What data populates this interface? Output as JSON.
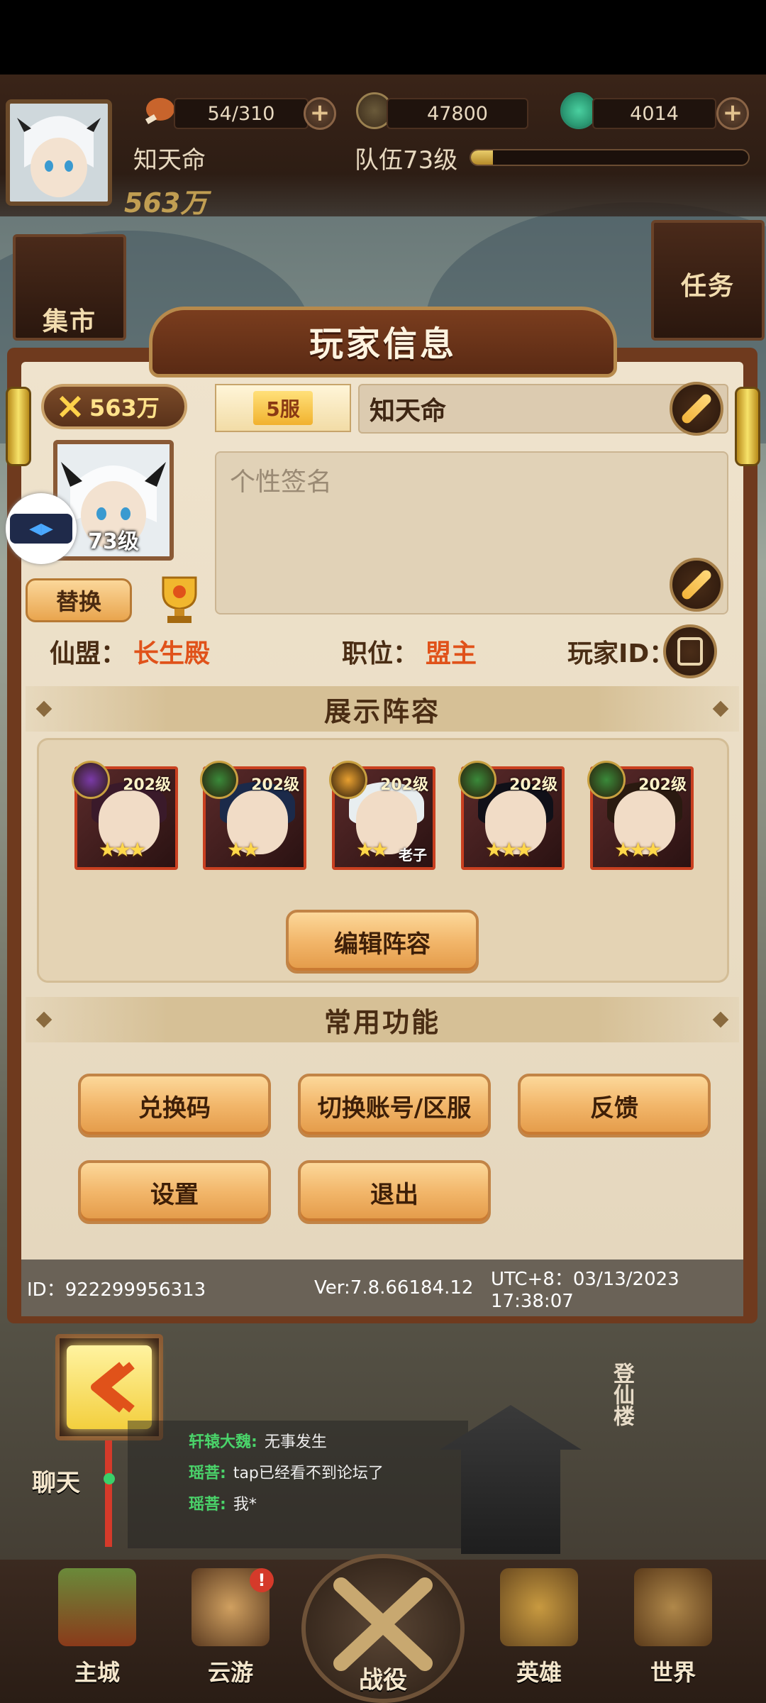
{
  "topbar": {
    "stamina": "54/310",
    "coins": "47800",
    "jade": "4014",
    "player_name": "知天命",
    "team_level": "队伍73级",
    "power": "563万",
    "plus": "+"
  },
  "side": {
    "market": "集市",
    "task": "任务"
  },
  "dialog": {
    "title": "玩家信息",
    "power": "563万",
    "server": "5服",
    "name": "知天命",
    "avatar_level": "73级",
    "signature_placeholder": "个性签名",
    "swap_button": "替换",
    "guild_label": "仙盟：",
    "guild_value": "长生殿",
    "position_label": "职位：",
    "position_value": "盟主",
    "player_id_label": "玩家ID："
  },
  "lineup": {
    "section_title": "展示阵容",
    "edit_button": "编辑阵容",
    "heroes": [
      {
        "level": "202级",
        "stars": "★★★",
        "tag": "",
        "hair": "#3a1a2a",
        "badge": "#7a3aa8"
      },
      {
        "level": "202级",
        "stars": "★★",
        "tag": "",
        "hair": "#1b2a4a",
        "badge": "#3a8a3a"
      },
      {
        "level": "202级",
        "stars": "★★",
        "tag": "老子",
        "hair": "#e8eef0",
        "badge": "#e8a030"
      },
      {
        "level": "202级",
        "stars": "★★★",
        "tag": "",
        "hair": "#101018",
        "badge": "#3a8a3a"
      },
      {
        "level": "202级",
        "stars": "★★★",
        "tag": "",
        "hair": "#2a1a10",
        "badge": "#3a8a3a"
      }
    ]
  },
  "functions": {
    "section_title": "常用功能",
    "redeem": "兑换码",
    "switch_account": "切换账号/区服",
    "feedback": "反馈",
    "settings": "设置",
    "logout": "退出"
  },
  "footer": {
    "id": "ID：922299956313",
    "version": "Ver:7.8.66184.12",
    "time": "UTC+8：03/13/2023 17:38:07"
  },
  "chat": {
    "label": "聊天",
    "messages": [
      {
        "user": "轩辕大魏:",
        "text": "无事发生"
      },
      {
        "user": "瑶菩:",
        "text": "tap已经看不到论坛了"
      },
      {
        "user": "瑶菩:",
        "text": "我*"
      }
    ]
  },
  "scene": {
    "tower_label": "登仙楼"
  },
  "nav": {
    "main_city": "主城",
    "roam": "云游",
    "battle": "战役",
    "heroes": "英雄",
    "world": "世界",
    "notice": "!"
  }
}
